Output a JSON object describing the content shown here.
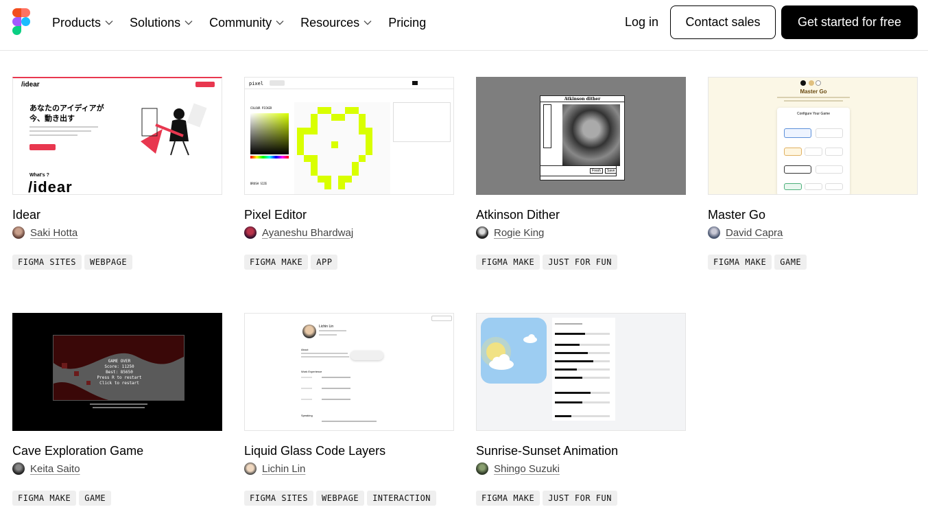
{
  "header": {
    "nav": [
      {
        "label": "Products",
        "has_menu": true
      },
      {
        "label": "Solutions",
        "has_menu": true
      },
      {
        "label": "Community",
        "has_menu": true
      },
      {
        "label": "Resources",
        "has_menu": true
      },
      {
        "label": "Pricing",
        "has_menu": false
      }
    ],
    "login_label": "Log in",
    "contact_label": "Contact sales",
    "cta_label": "Get started for free"
  },
  "cards": [
    {
      "title": "Idear",
      "author": "Saki Hotta",
      "tags": [
        "FIGMA SITES",
        "WEBPAGE"
      ],
      "thumb_text": {
        "logo": "/idear",
        "heading_1": "あなたのアイディアが",
        "heading_2": "今、動き出す",
        "whats": "What's ?",
        "big_logo": "/idear"
      }
    },
    {
      "title": "Pixel Editor",
      "author": "Ayaneshu Bhardwaj",
      "tags": [
        "FIGMA MAKE",
        "APP"
      ],
      "thumb_text": {
        "app_name": "pixel",
        "color_picker": "COLOUR PICKER",
        "brush_size": "BRUSH SIZE"
      }
    },
    {
      "title": "Atkinson Dither",
      "author": "Rogie King",
      "tags": [
        "FIGMA MAKE",
        "JUST FOR FUN"
      ],
      "thumb_text": {
        "window_title": "Atkinson dither",
        "btn1": "Fresh",
        "btn2": "Save"
      }
    },
    {
      "title": "Master Go",
      "author": "David Capra",
      "tags": [
        "FIGMA MAKE",
        "GAME"
      ],
      "thumb_text": {
        "heading": "Master Go",
        "panel_title": "Configure Your Game"
      }
    },
    {
      "title": "Cave Exploration Game",
      "author": "Keita Saito",
      "tags": [
        "FIGMA MAKE",
        "GAME"
      ],
      "thumb_text": {
        "line1": "GAME OVER",
        "line2": "Score: 11250",
        "line3": "Best: 85650",
        "line4": "Press R to restart",
        "line5": "Click to restart"
      }
    },
    {
      "title": "Liquid Glass Code Layers",
      "author": "Lichin Lin",
      "tags": [
        "FIGMA SITES",
        "WEBPAGE",
        "INTERACTION"
      ],
      "thumb_text": {
        "name": "Lichin Lin",
        "about": "About",
        "work": "Work Experience",
        "speaking": "Speaking"
      }
    },
    {
      "title": "Sunrise-Sunset Animation",
      "author": "Shingo Suzuki",
      "tags": [
        "FIGMA MAKE",
        "JUST FOR FUN"
      ],
      "thumb_text": {}
    }
  ],
  "colors": {
    "figma_red": "#f24e1e",
    "figma_orange": "#ff7262",
    "figma_purple": "#a259ff",
    "figma_blue": "#1abcfe",
    "figma_green": "#0acf83",
    "pixel_lime": "#d9ff00",
    "idear_red": "#e8374f"
  }
}
